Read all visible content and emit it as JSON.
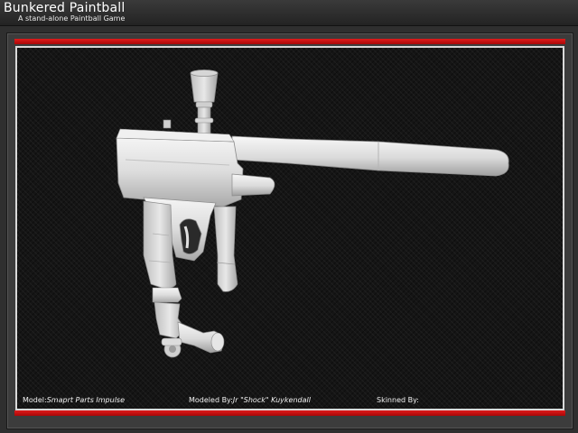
{
  "header": {
    "title": "Bunkered Paintball",
    "subtitle": "A stand-alone Paintball Game"
  },
  "viewer": {
    "model_label": "Model:",
    "model_name": "Smaprt Parts Impulse",
    "modeled_by_label": "Modeled By:",
    "modeled_by_name": "Jr \"Shock\" Kuykendall",
    "skinned_by_label": "Skinned By:",
    "skinned_by_name": ""
  },
  "colors": {
    "accent_red": "#d81010",
    "model_grey": "#e2e2e2",
    "background": "#151515"
  }
}
